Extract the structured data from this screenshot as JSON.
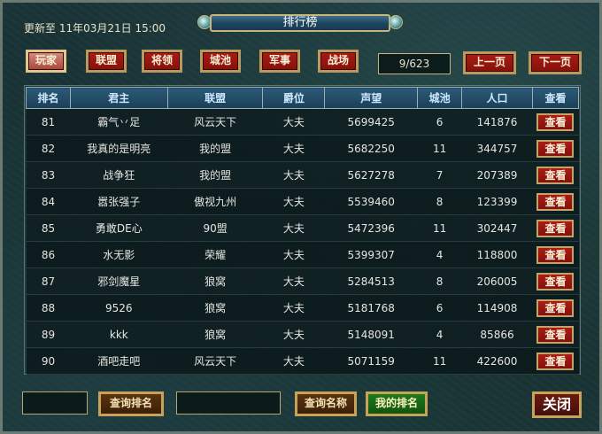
{
  "header": {
    "update_label": "更新至 11年03月21日 15:00",
    "title": "排行榜"
  },
  "tabs": [
    {
      "label": "玩家",
      "active": true
    },
    {
      "label": "联盟",
      "active": false
    },
    {
      "label": "将领",
      "active": false
    },
    {
      "label": "城池",
      "active": false
    },
    {
      "label": "军事",
      "active": false
    },
    {
      "label": "战场",
      "active": false
    }
  ],
  "pager": {
    "page_text": "9/623",
    "prev_label": "上一页",
    "next_label": "下一页"
  },
  "table": {
    "columns": [
      "排名",
      "君主",
      "联盟",
      "爵位",
      "声望",
      "城池",
      "人口",
      "查看"
    ],
    "view_label": "查看",
    "rows": [
      {
        "rank": "81",
        "lord": "霸气丷足",
        "alliance": "风云天下",
        "title": "大夫",
        "prestige": "5699425",
        "cities": "6",
        "population": "141876"
      },
      {
        "rank": "82",
        "lord": "我真的是明亮",
        "alliance": "我的盟",
        "title": "大夫",
        "prestige": "5682250",
        "cities": "11",
        "population": "344757"
      },
      {
        "rank": "83",
        "lord": "战争狂",
        "alliance": "我的盟",
        "title": "大夫",
        "prestige": "5627278",
        "cities": "7",
        "population": "207389"
      },
      {
        "rank": "84",
        "lord": "嚣张强子",
        "alliance": "傲视九州",
        "title": "大夫",
        "prestige": "5539460",
        "cities": "8",
        "population": "123399"
      },
      {
        "rank": "85",
        "lord": "勇敢DE心",
        "alliance": "90盟",
        "title": "大夫",
        "prestige": "5472396",
        "cities": "11",
        "population": "302447"
      },
      {
        "rank": "86",
        "lord": "水无影",
        "alliance": "荣耀",
        "title": "大夫",
        "prestige": "5399307",
        "cities": "4",
        "population": "118800"
      },
      {
        "rank": "87",
        "lord": "邪剑魔星",
        "alliance": "狼窝",
        "title": "大夫",
        "prestige": "5284513",
        "cities": "8",
        "population": "206005"
      },
      {
        "rank": "88",
        "lord": "9526",
        "alliance": "狼窝",
        "title": "大夫",
        "prestige": "5181768",
        "cities": "6",
        "population": "114908"
      },
      {
        "rank": "89",
        "lord": "kkk",
        "alliance": "狼窝",
        "title": "大夫",
        "prestige": "5148091",
        "cities": "4",
        "population": "85866"
      },
      {
        "rank": "90",
        "lord": "酒吧走吧",
        "alliance": "风云天下",
        "title": "大夫",
        "prestige": "5071159",
        "cities": "11",
        "population": "422600"
      }
    ]
  },
  "footer": {
    "rank_input_value": "",
    "query_rank_label": "查询排名",
    "name_input_value": "",
    "query_name_label": "查询名称",
    "my_rank_label": "我的排名",
    "close_label": "关闭"
  }
}
